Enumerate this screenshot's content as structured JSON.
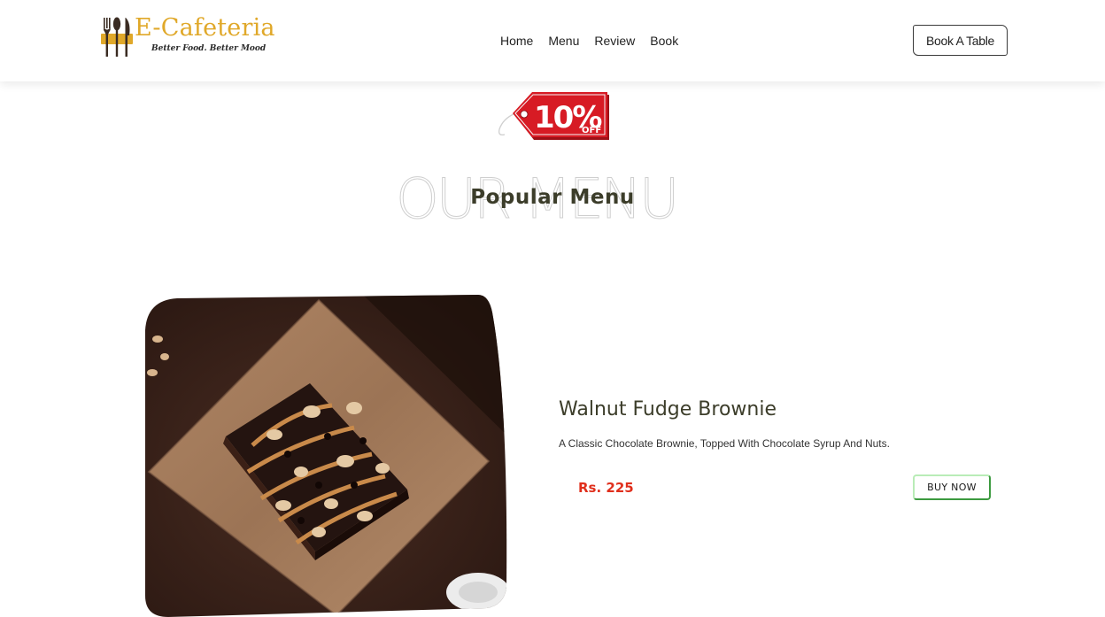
{
  "header": {
    "logo_name": "E-Cafeteria",
    "logo_tagline": "Better Food. Better Mood",
    "nav": [
      "Home",
      "Menu",
      "Review",
      "Book"
    ],
    "book_button": "Book A Table"
  },
  "promo": {
    "discount": "10%",
    "off_label": "OFF"
  },
  "section": {
    "outline_title": "OUR MENU",
    "title": "Popular Menu"
  },
  "product": {
    "name": "Walnut Fudge Brownie",
    "description": "A Classic Chocolate Brownie, Topped With Chocolate Syrup And Nuts.",
    "price": "Rs. 225",
    "buy_button": "BUY NOW"
  },
  "colors": {
    "brand": "#e0a829",
    "heading": "#3c3d2a",
    "price": "#e02f1c",
    "promo_red": "#d71b24",
    "buy_border": "#3c9a3f"
  },
  "icons": {
    "logo": "cutlery-icon",
    "promo": "price-tag-icon"
  }
}
